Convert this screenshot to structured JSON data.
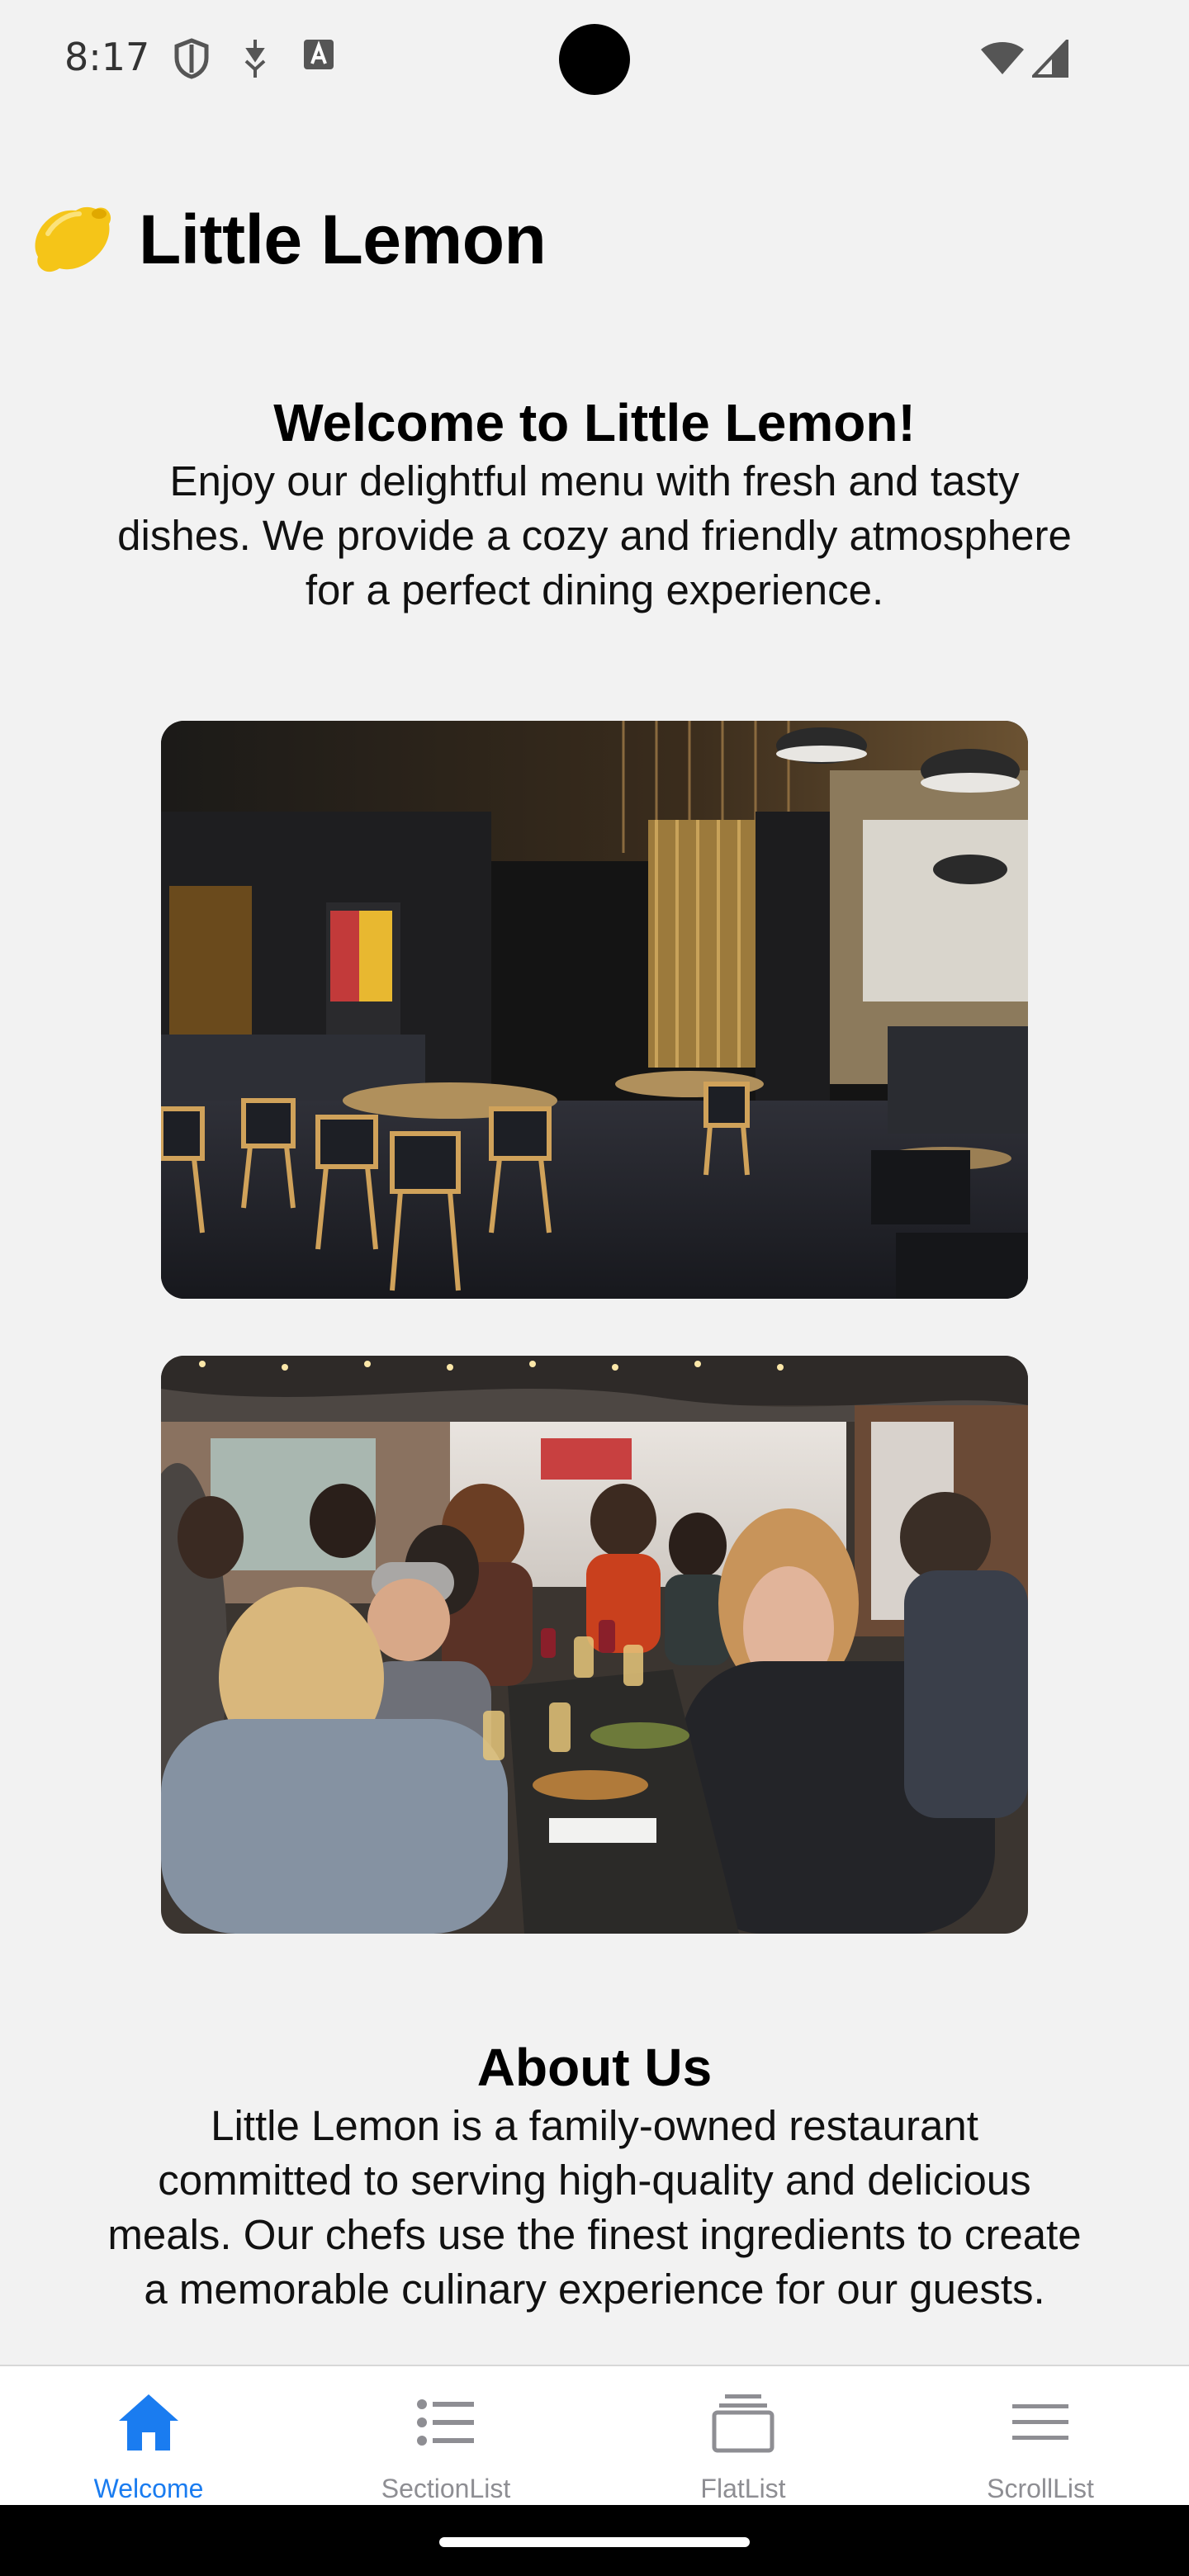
{
  "status_bar": {
    "time": "8:17"
  },
  "header": {
    "icon": "lemon-icon",
    "title": "Little Lemon"
  },
  "welcome": {
    "heading": "Welcome to Little Lemon!",
    "body_lines": [
      "Enjoy our delightful menu with fresh and tasty",
      "dishes. We provide a cozy and friendly atmosphere",
      "for a perfect dining experience."
    ]
  },
  "photos": [
    {
      "name": "restaurant-interior-photo"
    },
    {
      "name": "diners-at-table-photo"
    }
  ],
  "about": {
    "heading": "About Us",
    "body_lines": [
      "Little Lemon is a family-owned restaurant",
      "committed to serving high-quality and delicious",
      "meals. Our chefs use the finest ingredients to create",
      "a memorable culinary experience for our guests."
    ]
  },
  "tabs": [
    {
      "label": "Welcome",
      "icon": "home-icon",
      "active": true
    },
    {
      "label": "SectionList",
      "icon": "list-icon",
      "active": false
    },
    {
      "label": "FlatList",
      "icon": "stack-icon",
      "active": false
    },
    {
      "label": "ScrollList",
      "icon": "menu-icon",
      "active": false
    }
  ],
  "colors": {
    "accent": "#1a7cf0",
    "inactive": "#8e8e93",
    "background": "#f2f2f2"
  }
}
